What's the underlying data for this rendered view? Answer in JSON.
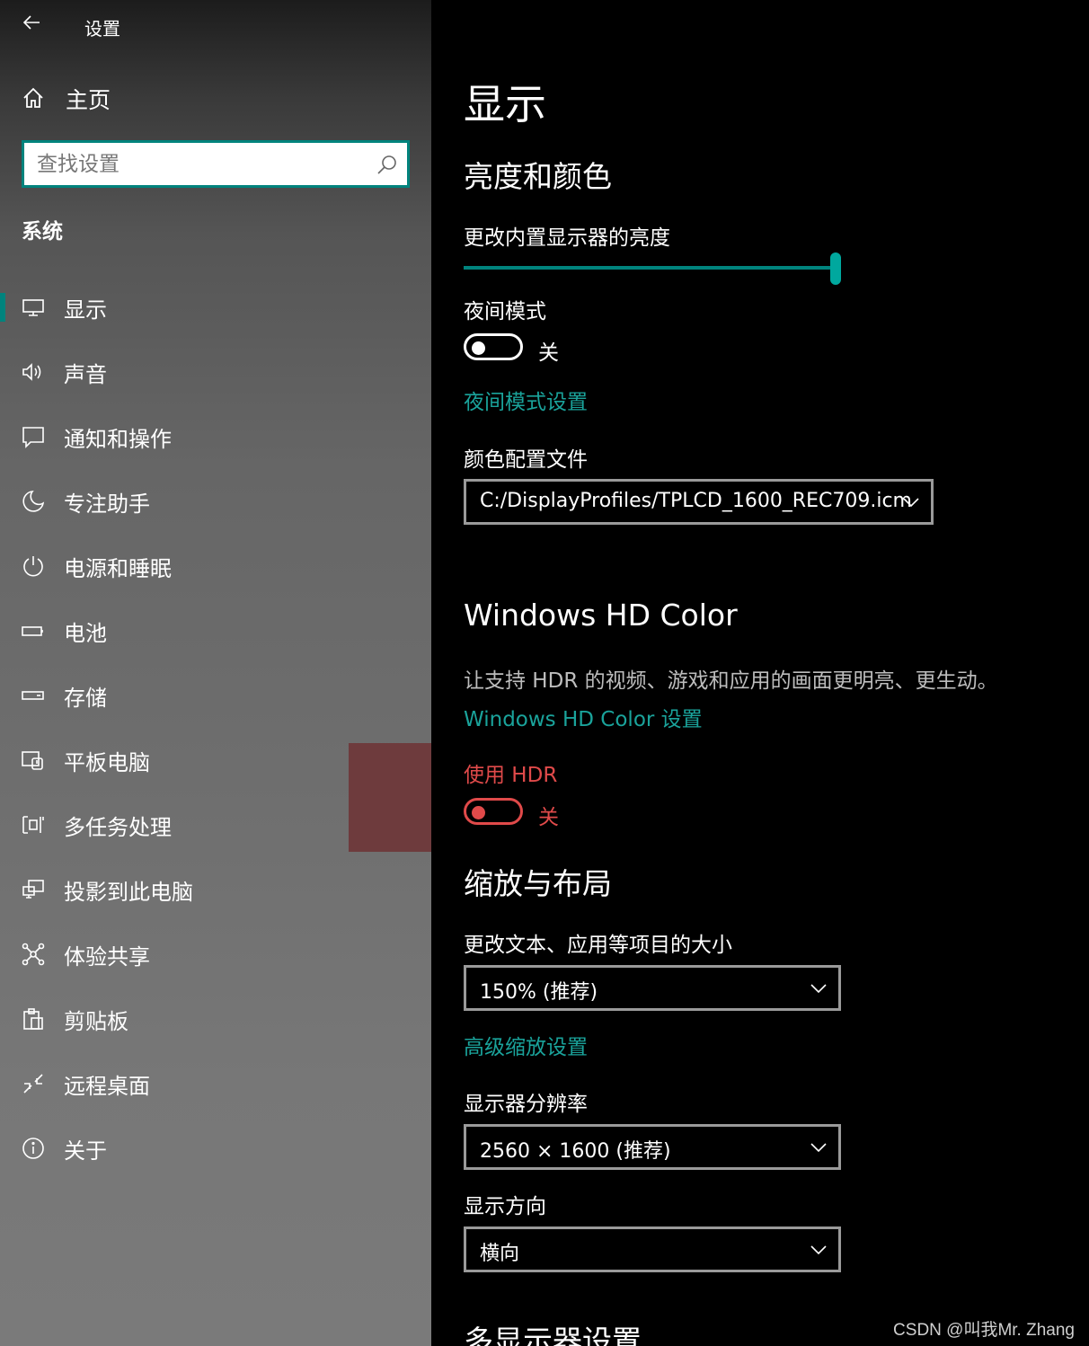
{
  "window": {
    "title": "设置"
  },
  "sidebar": {
    "home_label": "主页",
    "search_placeholder": "查找设置",
    "section": "系统",
    "items": [
      {
        "label": "显示",
        "icon": "monitor-icon",
        "active": true
      },
      {
        "label": "声音",
        "icon": "speaker-icon"
      },
      {
        "label": "通知和操作",
        "icon": "notification-icon"
      },
      {
        "label": "专注助手",
        "icon": "moon-icon"
      },
      {
        "label": "电源和睡眠",
        "icon": "power-icon"
      },
      {
        "label": "电池",
        "icon": "battery-icon"
      },
      {
        "label": "存储",
        "icon": "storage-icon"
      },
      {
        "label": "平板电脑",
        "icon": "tablet-icon"
      },
      {
        "label": "多任务处理",
        "icon": "multitasking-icon"
      },
      {
        "label": "投影到此电脑",
        "icon": "project-icon"
      },
      {
        "label": "体验共享",
        "icon": "shared-experience-icon"
      },
      {
        "label": "剪贴板",
        "icon": "clipboard-icon"
      },
      {
        "label": "远程桌面",
        "icon": "remote-desktop-icon"
      },
      {
        "label": "关于",
        "icon": "info-icon"
      }
    ]
  },
  "main": {
    "title": "显示",
    "brightness_section": "亮度和颜色",
    "brightness_label": "更改内置显示器的亮度",
    "brightness_value": 100,
    "night_light_label": "夜间模式",
    "night_light_state": "关",
    "night_light_settings_link": "夜间模式设置",
    "color_profile_label": "颜色配置文件",
    "color_profile_value": "C:/DisplayProfiles/TPLCD_1600_REC709.icm",
    "hd_color_section": "Windows HD Color",
    "hd_color_desc": "让支持 HDR 的视频、游戏和应用的画面更明亮、更生动。",
    "hd_color_link": "Windows HD Color 设置",
    "hdr_label": "使用 HDR",
    "hdr_state": "关",
    "scale_section": "缩放与布局",
    "scale_label": "更改文本、应用等项目的大小",
    "scale_value": "150% (推荐)",
    "advanced_scale_link": "高级缩放设置",
    "resolution_label": "显示器分辨率",
    "resolution_value": "2560 × 1600 (推荐)",
    "orientation_label": "显示方向",
    "orientation_value": "横向",
    "multi_display_section": "多显示器设置"
  },
  "watermark": "CSDN @叫我Mr. Zhang",
  "colors": {
    "accent": "#00837d",
    "link": "#1aa39b",
    "hdr_red": "#e04a4a",
    "hover_block": "#6e3b3d"
  }
}
